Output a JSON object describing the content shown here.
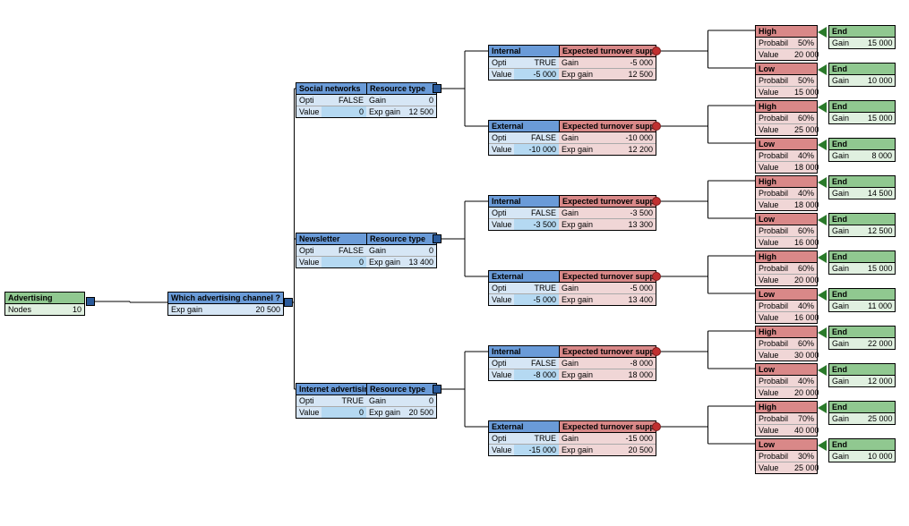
{
  "root": {
    "title": "Advertising",
    "nodes_label": "Nodes",
    "nodes": "10",
    "exp_gain_label": "Exp gain",
    "exp_gain": "20 500"
  },
  "q1": "Which advertising channel ?",
  "labels": {
    "opti": "Opti",
    "value": "Value",
    "gain": "Gain",
    "exp_gain": "Exp gain",
    "probabil": "Probabil",
    "resource_type": "Resource type",
    "expected": "Expected turnover supposition",
    "end": "End",
    "high": "High",
    "low": "Low",
    "internal": "Internal",
    "external": "External"
  },
  "channels": [
    {
      "name": "Social networks",
      "opti": "FALSE",
      "value": "0",
      "gain": "0",
      "exp_gain": "12 500",
      "branches": [
        {
          "name": "Internal",
          "opti": "TRUE",
          "value": "-5 000",
          "gain": "-5 000",
          "exp_gain": "12 500",
          "hl": [
            {
              "n": "High",
              "prob": "50%",
              "val": "20 000",
              "end_gain": "15 000"
            },
            {
              "n": "Low",
              "prob": "50%",
              "val": "15 000",
              "end_gain": "10 000"
            }
          ]
        },
        {
          "name": "External",
          "opti": "FALSE",
          "value": "-10 000",
          "gain": "-10 000",
          "exp_gain": "12 200",
          "hl": [
            {
              "n": "High",
              "prob": "60%",
              "val": "25 000",
              "end_gain": "15 000"
            },
            {
              "n": "Low",
              "prob": "40%",
              "val": "18 000",
              "end_gain": "8 000"
            }
          ]
        }
      ]
    },
    {
      "name": "Newsletter",
      "opti": "FALSE",
      "value": "0",
      "gain": "0",
      "exp_gain": "13 400",
      "branches": [
        {
          "name": "Internal",
          "opti": "FALSE",
          "value": "-3 500",
          "gain": "-3 500",
          "exp_gain": "13 300",
          "hl": [
            {
              "n": "High",
              "prob": "40%",
              "val": "18 000",
              "end_gain": "14 500"
            },
            {
              "n": "Low",
              "prob": "60%",
              "val": "16 000",
              "end_gain": "12 500"
            }
          ]
        },
        {
          "name": "External",
          "opti": "TRUE",
          "value": "-5 000",
          "gain": "-5 000",
          "exp_gain": "13 400",
          "hl": [
            {
              "n": "High",
              "prob": "60%",
              "val": "20 000",
              "end_gain": "15 000"
            },
            {
              "n": "Low",
              "prob": "40%",
              "val": "16 000",
              "end_gain": "11 000"
            }
          ]
        }
      ]
    },
    {
      "name": "Internet advertising",
      "opti": "TRUE",
      "value": "0",
      "gain": "0",
      "exp_gain": "20 500",
      "branches": [
        {
          "name": "Internal",
          "opti": "FALSE",
          "value": "-8 000",
          "gain": "-8 000",
          "exp_gain": "18 000",
          "hl": [
            {
              "n": "High",
              "prob": "60%",
              "val": "30 000",
              "end_gain": "22 000"
            },
            {
              "n": "Low",
              "prob": "40%",
              "val": "20 000",
              "end_gain": "12 000"
            }
          ]
        },
        {
          "name": "External",
          "opti": "TRUE",
          "value": "-15 000",
          "gain": "-15 000",
          "exp_gain": "20 500",
          "hl": [
            {
              "n": "High",
              "prob": "70%",
              "val": "40 000",
              "end_gain": "25 000"
            },
            {
              "n": "Low",
              "prob": "30%",
              "val": "25 000",
              "end_gain": "10 000"
            }
          ]
        }
      ]
    }
  ]
}
